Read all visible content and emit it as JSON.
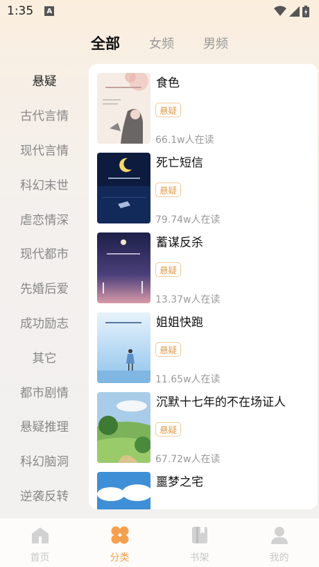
{
  "status": {
    "time": "1:35",
    "notif": "A"
  },
  "tabs": [
    {
      "label": "全部",
      "active": true
    },
    {
      "label": "女频",
      "active": false
    },
    {
      "label": "男频",
      "active": false
    }
  ],
  "sidebar": [
    {
      "label": "悬疑",
      "active": true
    },
    {
      "label": "古代言情"
    },
    {
      "label": "现代言情"
    },
    {
      "label": "科幻末世"
    },
    {
      "label": "虐恋情深"
    },
    {
      "label": "现代都市"
    },
    {
      "label": "先婚后爱"
    },
    {
      "label": "成功励志"
    },
    {
      "label": "其它"
    },
    {
      "label": "都市剧情"
    },
    {
      "label": "悬疑推理"
    },
    {
      "label": "科幻脑洞"
    },
    {
      "label": "逆袭反转"
    }
  ],
  "books": [
    {
      "title": "食色",
      "tag": "悬疑",
      "readers": "66.1w人在读"
    },
    {
      "title": "死亡短信",
      "tag": "悬疑",
      "readers": "79.74w人在读"
    },
    {
      "title": "蓄谋反杀",
      "tag": "悬疑",
      "readers": "13.37w人在读"
    },
    {
      "title": "姐姐快跑",
      "tag": "悬疑",
      "readers": "11.65w人在读"
    },
    {
      "title": "沉默十七年的不在场证人",
      "tag": "悬疑",
      "readers": "67.72w人在读"
    },
    {
      "title": "噩梦之宅"
    }
  ],
  "bottom_nav": [
    {
      "label": "首页",
      "icon": "home-icon"
    },
    {
      "label": "分类",
      "icon": "category-icon",
      "active": true
    },
    {
      "label": "书架",
      "icon": "bookshelf-icon"
    },
    {
      "label": "我的",
      "icon": "profile-icon"
    }
  ],
  "colors": {
    "accent": "#f5a04c",
    "tag_border": "#f2c99a",
    "tag_text": "#e29a45"
  }
}
